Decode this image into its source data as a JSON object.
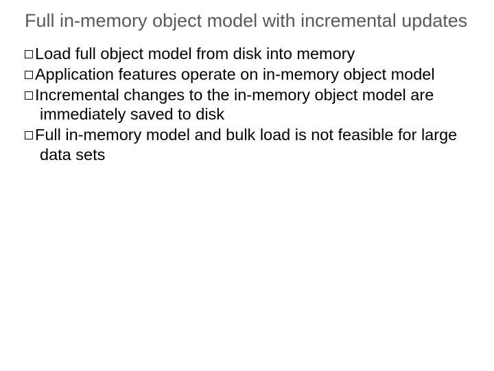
{
  "title": "Full in-memory object model with incremental updates",
  "bullets": [
    "Load full object model from disk into memory",
    "Application features operate on in-memory object model",
    "Incremental changes to the in-memory object model are immediately saved to disk",
    "Full in-memory model and bulk load is not feasible for large data sets"
  ]
}
